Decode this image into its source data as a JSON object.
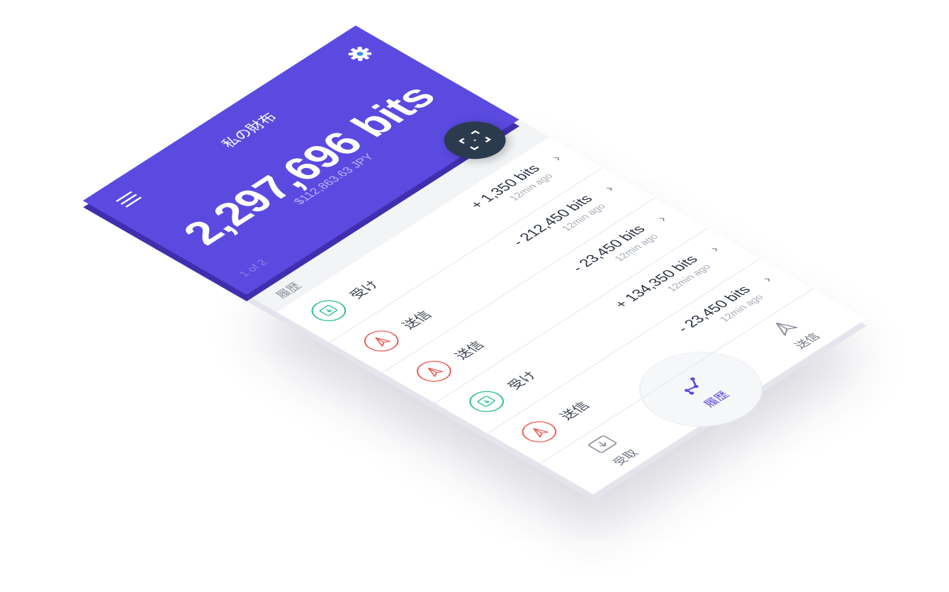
{
  "header": {
    "title": "私の財布",
    "balance": "2,297,696 bits",
    "fiat": "$112,863.63 JPY",
    "pager": "1 of 2",
    "menu_icon": "hamburger-menu-icon",
    "settings_icon": "gear-icon",
    "scan_icon": "scan-qr-icon"
  },
  "history": {
    "label": "履歴",
    "items": [
      {
        "type": "receive",
        "label": "受け",
        "amount": "+ 1,350 bits",
        "time": "12min ago"
      },
      {
        "type": "send",
        "label": "送信",
        "amount": "- 212,450 bits",
        "time": "12min ago"
      },
      {
        "type": "send",
        "label": "送信",
        "amount": "- 23,450 bits",
        "time": "12min ago"
      },
      {
        "type": "receive",
        "label": "受け",
        "amount": "+ 134,350 bits",
        "time": "12min ago"
      },
      {
        "type": "send",
        "label": "送信",
        "amount": "- 23,450 bits",
        "time": "12min ago"
      }
    ]
  },
  "nav": {
    "tabs": [
      {
        "label": "受取",
        "icon": "receive-box-icon"
      },
      {
        "label": "履歴",
        "icon": "history-graph-icon",
        "active": true
      },
      {
        "label": "送信",
        "icon": "paper-plane-icon"
      }
    ]
  },
  "colors": {
    "primary": "#5a4ae0",
    "receive": "#2bbf94",
    "send": "#ee5a52",
    "fab": "#2c3a4d"
  }
}
